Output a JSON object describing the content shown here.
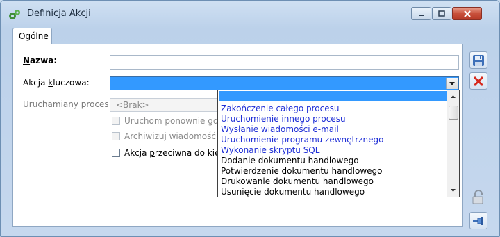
{
  "window": {
    "title": "Definicja Akcji"
  },
  "tabs": [
    {
      "label": "Ogólne"
    }
  ],
  "form": {
    "nazwa_label_u": "N",
    "nazwa_label_rest": "azwa:",
    "nazwa_value": "",
    "akcja_label_pre": "Akcja ",
    "akcja_label_u": "k",
    "akcja_label_post": "luczowa:",
    "akcja_value": "",
    "uruchamiany_label": "Uruchamiany proces:",
    "uruchamiany_value": "<Brak>",
    "chk_uruchom": "Uruchom ponownie gdy",
    "chk_archiwizuj": "Archiwizuj wiadomość e",
    "chk_przeciwna_pre": "Akcja ",
    "chk_przeciwna_u": "p",
    "chk_przeciwna_post": "rzeciwna do kier"
  },
  "dropdown": {
    "selected_value": "",
    "options": [
      {
        "label": "Zakończenie całego procesu",
        "color": "#1f2fd6"
      },
      {
        "label": "Uruchomienie innego procesu",
        "color": "#1f2fd6"
      },
      {
        "label": "Wysłanie wiadomości e-mail",
        "color": "#1f2fd6"
      },
      {
        "label": "Uruchomienie programu zewnętrznego",
        "color": "#1f2fd6"
      },
      {
        "label": "Wykonanie skryptu SQL",
        "color": "#1f2fd6"
      },
      {
        "label": "Dodanie dokumentu handlowego",
        "color": "#000000"
      },
      {
        "label": "Potwierdzenie dokumentu handlowego",
        "color": "#000000"
      },
      {
        "label": "Drukowanie dokumentu handlowego",
        "color": "#000000"
      },
      {
        "label": "Usunięcie dokumentu handlowego",
        "color": "#000000"
      }
    ]
  },
  "icons": {
    "app": "gears-icon",
    "save": "floppy-disk-icon",
    "cancel": "red-x-icon",
    "lock": "padlock-icon",
    "pin": "pin-icon"
  },
  "colors": {
    "selection": "#3399ff",
    "blue_item": "#1f2fd6",
    "cancel_red": "#d6281c"
  }
}
